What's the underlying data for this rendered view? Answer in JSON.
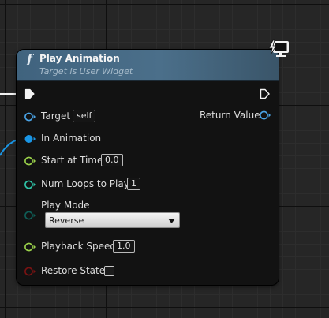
{
  "node": {
    "icon": "function-icon",
    "title": "Play Animation",
    "subtitle": "Target is User Widget"
  },
  "inputs": {
    "exec": {
      "icon": "exec-in-pin-icon"
    },
    "target": {
      "label": "Target",
      "value": "self",
      "color": "#4aa3e6"
    },
    "in_animation": {
      "label": "In Animation",
      "color": "#1a96e6"
    },
    "start_at_time": {
      "label": "Start at Time",
      "value": "0.0",
      "color": "#9bd24a"
    },
    "num_loops": {
      "label": "Num Loops to Play",
      "value": "1",
      "color": "#2fc4a8"
    },
    "play_mode": {
      "label": "Play Mode",
      "value": "Reverse",
      "color": "#0f5e57"
    },
    "playback_speed": {
      "label": "Playback Speed",
      "value": "1.0",
      "color": "#9bd24a"
    },
    "restore_state": {
      "label": "Restore State",
      "checked": false,
      "color": "#7a1212"
    }
  },
  "outputs": {
    "exec": {
      "icon": "exec-out-pin-icon"
    },
    "return_value": {
      "label": "Return Value",
      "color": "#4aa3e6"
    }
  },
  "badge": {
    "icon": "lightning-monitor-icon"
  }
}
